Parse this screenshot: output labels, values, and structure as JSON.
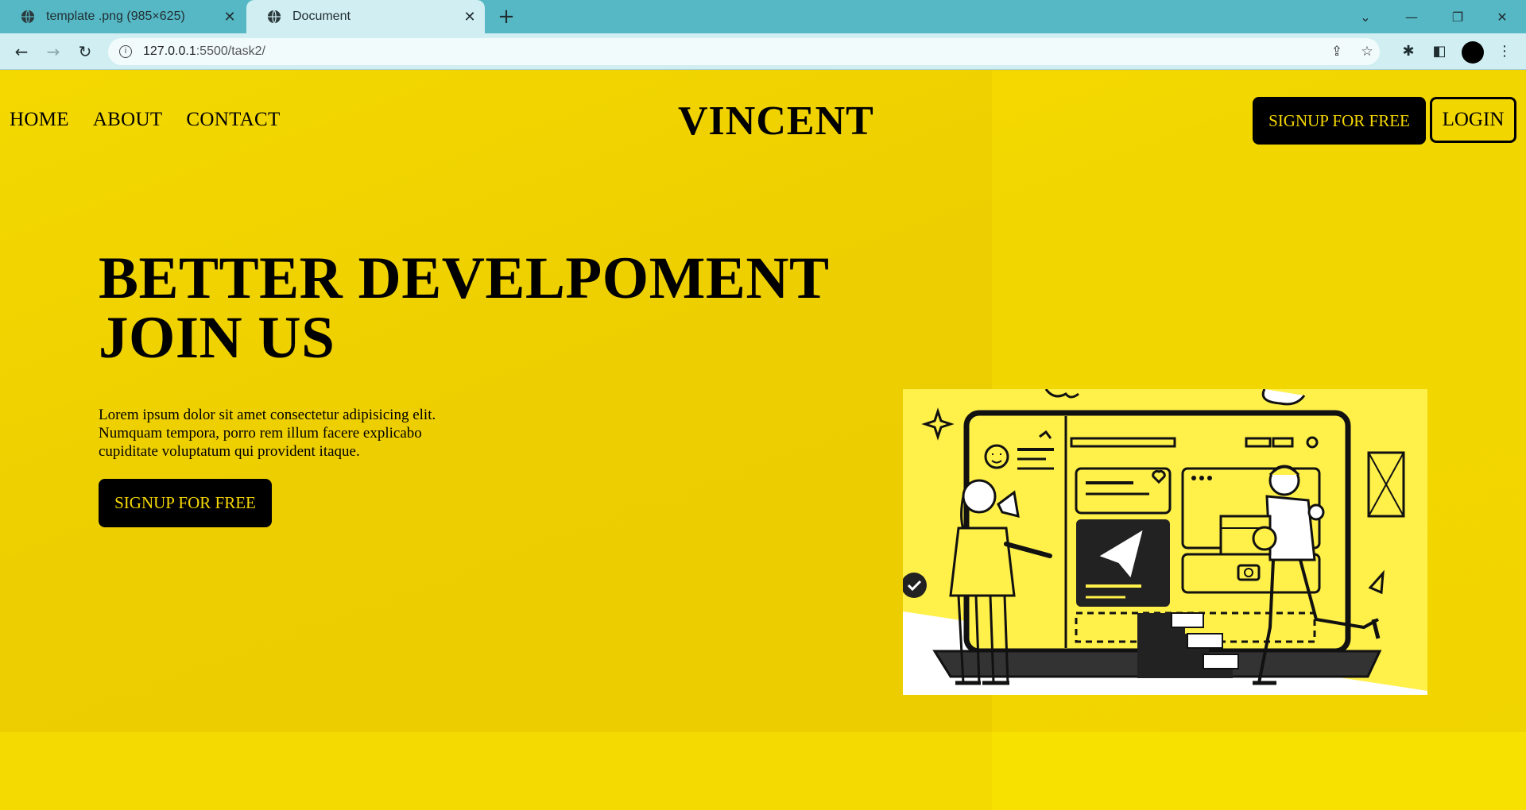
{
  "browser": {
    "tabs": [
      {
        "label": "template .png (985×625)",
        "icon": "globe-icon",
        "active": false
      },
      {
        "label": "Document",
        "icon": "globe-icon",
        "active": true
      }
    ],
    "new_tab_icon": "plus-icon",
    "url_host": "127.0.0.1",
    "url_path": ":5500/task2/",
    "colors": {
      "tabstrip": "#56b8c5",
      "toolbar": "#d1eef2"
    }
  },
  "site": {
    "nav": {
      "home": "HOME",
      "about": "ABOUT",
      "contact": "CONTACT"
    },
    "brand": "VINCENT",
    "signup_top": "SIGNUP FOR FREE",
    "login": "LOGIN",
    "hero": {
      "title_line1": "BETTER DEVELPOMENT",
      "title_line2": "JOIN US",
      "text": "Lorem ipsum dolor sit amet consectetur adipisicing elit. Numquam tempora, porro rem illum facere explicabo cupiditate voluptatum qui provident itaque.",
      "signup": "SIGNUP FOR FREE"
    },
    "colors": {
      "accent": "#f0d200",
      "button_bg": "#000000",
      "button_text": "#f6d800"
    }
  }
}
